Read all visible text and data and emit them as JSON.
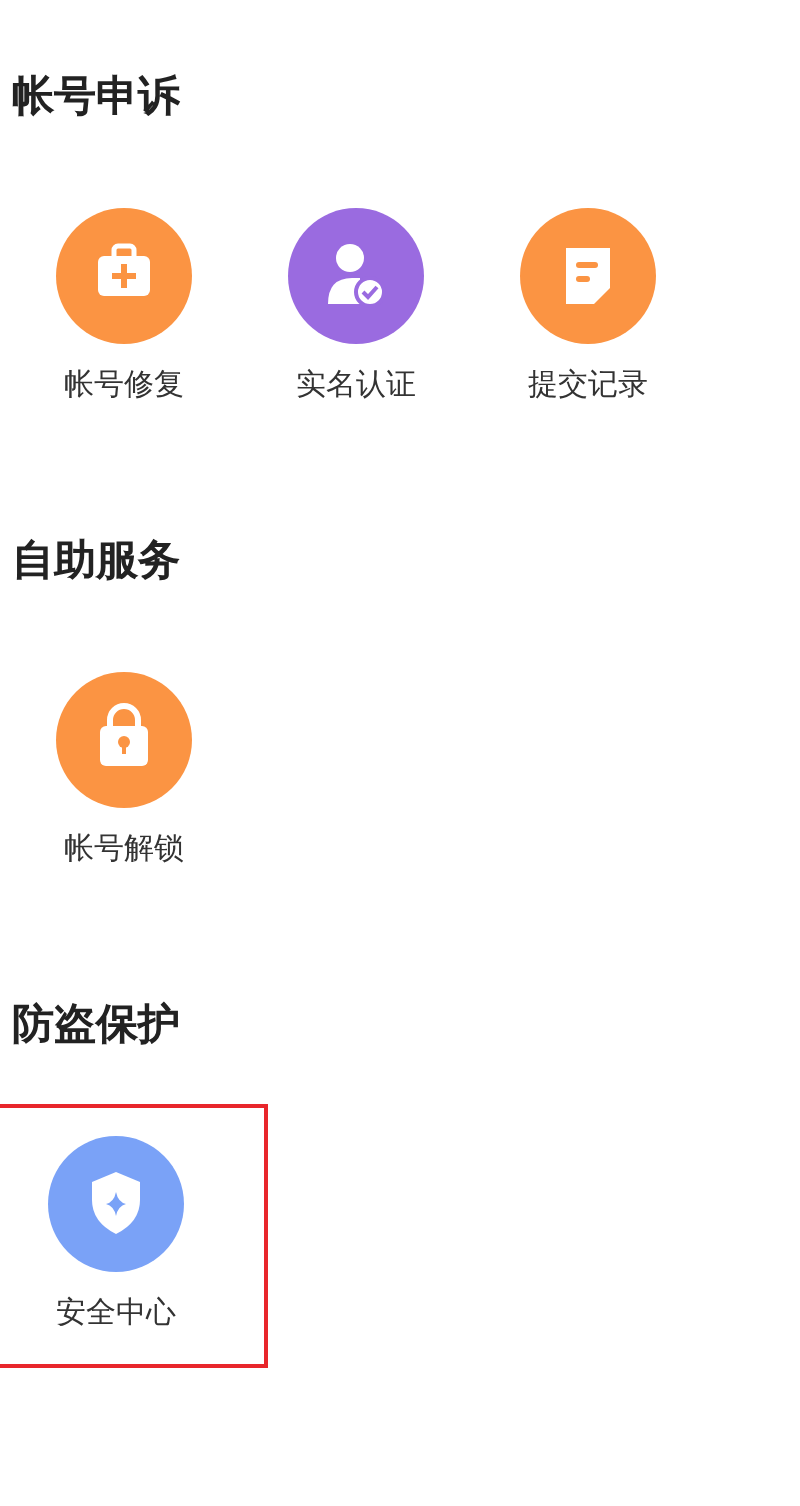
{
  "sections": [
    {
      "title": "帐号申诉",
      "items": [
        {
          "label": "帐号修复",
          "kind": "kit",
          "color": "#fb9443",
          "highlighted": false
        },
        {
          "label": "实名认证",
          "kind": "user-check",
          "color": "#9a6be0",
          "highlighted": false
        },
        {
          "label": "提交记录",
          "kind": "note",
          "color": "#fb9443",
          "highlighted": false
        }
      ]
    },
    {
      "title": "自助服务",
      "items": [
        {
          "label": "帐号解锁",
          "kind": "lock",
          "color": "#fb9443",
          "highlighted": false
        }
      ]
    },
    {
      "title": "防盗保护",
      "items": [
        {
          "label": "安全中心",
          "kind": "shield",
          "color": "#7aa2f7",
          "highlighted": true
        }
      ]
    }
  ]
}
